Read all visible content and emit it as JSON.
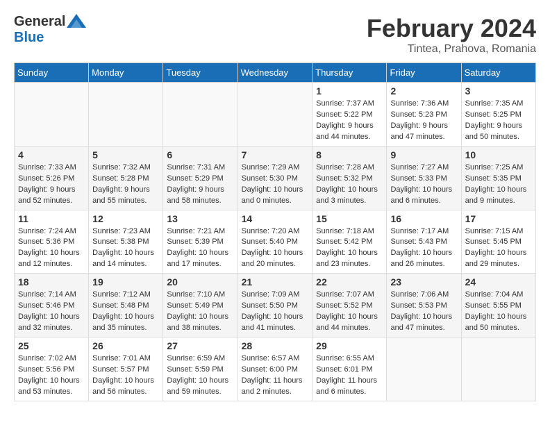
{
  "header": {
    "logo_general": "General",
    "logo_blue": "Blue",
    "month_title": "February 2024",
    "location": "Tintea, Prahova, Romania"
  },
  "weekdays": [
    "Sunday",
    "Monday",
    "Tuesday",
    "Wednesday",
    "Thursday",
    "Friday",
    "Saturday"
  ],
  "weeks": [
    [
      {
        "day": "",
        "info": ""
      },
      {
        "day": "",
        "info": ""
      },
      {
        "day": "",
        "info": ""
      },
      {
        "day": "",
        "info": ""
      },
      {
        "day": "1",
        "info": "Sunrise: 7:37 AM\nSunset: 5:22 PM\nDaylight: 9 hours and 44 minutes."
      },
      {
        "day": "2",
        "info": "Sunrise: 7:36 AM\nSunset: 5:23 PM\nDaylight: 9 hours and 47 minutes."
      },
      {
        "day": "3",
        "info": "Sunrise: 7:35 AM\nSunset: 5:25 PM\nDaylight: 9 hours and 50 minutes."
      }
    ],
    [
      {
        "day": "4",
        "info": "Sunrise: 7:33 AM\nSunset: 5:26 PM\nDaylight: 9 hours and 52 minutes."
      },
      {
        "day": "5",
        "info": "Sunrise: 7:32 AM\nSunset: 5:28 PM\nDaylight: 9 hours and 55 minutes."
      },
      {
        "day": "6",
        "info": "Sunrise: 7:31 AM\nSunset: 5:29 PM\nDaylight: 9 hours and 58 minutes."
      },
      {
        "day": "7",
        "info": "Sunrise: 7:29 AM\nSunset: 5:30 PM\nDaylight: 10 hours and 0 minutes."
      },
      {
        "day": "8",
        "info": "Sunrise: 7:28 AM\nSunset: 5:32 PM\nDaylight: 10 hours and 3 minutes."
      },
      {
        "day": "9",
        "info": "Sunrise: 7:27 AM\nSunset: 5:33 PM\nDaylight: 10 hours and 6 minutes."
      },
      {
        "day": "10",
        "info": "Sunrise: 7:25 AM\nSunset: 5:35 PM\nDaylight: 10 hours and 9 minutes."
      }
    ],
    [
      {
        "day": "11",
        "info": "Sunrise: 7:24 AM\nSunset: 5:36 PM\nDaylight: 10 hours and 12 minutes."
      },
      {
        "day": "12",
        "info": "Sunrise: 7:23 AM\nSunset: 5:38 PM\nDaylight: 10 hours and 14 minutes."
      },
      {
        "day": "13",
        "info": "Sunrise: 7:21 AM\nSunset: 5:39 PM\nDaylight: 10 hours and 17 minutes."
      },
      {
        "day": "14",
        "info": "Sunrise: 7:20 AM\nSunset: 5:40 PM\nDaylight: 10 hours and 20 minutes."
      },
      {
        "day": "15",
        "info": "Sunrise: 7:18 AM\nSunset: 5:42 PM\nDaylight: 10 hours and 23 minutes."
      },
      {
        "day": "16",
        "info": "Sunrise: 7:17 AM\nSunset: 5:43 PM\nDaylight: 10 hours and 26 minutes."
      },
      {
        "day": "17",
        "info": "Sunrise: 7:15 AM\nSunset: 5:45 PM\nDaylight: 10 hours and 29 minutes."
      }
    ],
    [
      {
        "day": "18",
        "info": "Sunrise: 7:14 AM\nSunset: 5:46 PM\nDaylight: 10 hours and 32 minutes."
      },
      {
        "day": "19",
        "info": "Sunrise: 7:12 AM\nSunset: 5:48 PM\nDaylight: 10 hours and 35 minutes."
      },
      {
        "day": "20",
        "info": "Sunrise: 7:10 AM\nSunset: 5:49 PM\nDaylight: 10 hours and 38 minutes."
      },
      {
        "day": "21",
        "info": "Sunrise: 7:09 AM\nSunset: 5:50 PM\nDaylight: 10 hours and 41 minutes."
      },
      {
        "day": "22",
        "info": "Sunrise: 7:07 AM\nSunset: 5:52 PM\nDaylight: 10 hours and 44 minutes."
      },
      {
        "day": "23",
        "info": "Sunrise: 7:06 AM\nSunset: 5:53 PM\nDaylight: 10 hours and 47 minutes."
      },
      {
        "day": "24",
        "info": "Sunrise: 7:04 AM\nSunset: 5:55 PM\nDaylight: 10 hours and 50 minutes."
      }
    ],
    [
      {
        "day": "25",
        "info": "Sunrise: 7:02 AM\nSunset: 5:56 PM\nDaylight: 10 hours and 53 minutes."
      },
      {
        "day": "26",
        "info": "Sunrise: 7:01 AM\nSunset: 5:57 PM\nDaylight: 10 hours and 56 minutes."
      },
      {
        "day": "27",
        "info": "Sunrise: 6:59 AM\nSunset: 5:59 PM\nDaylight: 10 hours and 59 minutes."
      },
      {
        "day": "28",
        "info": "Sunrise: 6:57 AM\nSunset: 6:00 PM\nDaylight: 11 hours and 2 minutes."
      },
      {
        "day": "29",
        "info": "Sunrise: 6:55 AM\nSunset: 6:01 PM\nDaylight: 11 hours and 6 minutes."
      },
      {
        "day": "",
        "info": ""
      },
      {
        "day": "",
        "info": ""
      }
    ]
  ]
}
